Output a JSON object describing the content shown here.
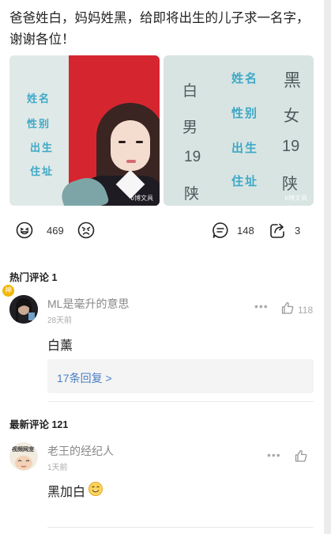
{
  "post": {
    "title": "爸爸姓白，妈妈姓黑，给即将出生的儿子求一名字，谢谢各位！"
  },
  "photo_left": {
    "fields": [
      "姓名",
      "性别",
      "出生",
      "住址"
    ],
    "watermark": "b博文具"
  },
  "photo_right": {
    "fields": [
      "姓名",
      "性别",
      "出生",
      "住址"
    ],
    "values": [
      "黑",
      "女",
      "19",
      "陕"
    ],
    "partial_chars": [
      "白",
      "男",
      "19",
      "陕"
    ],
    "watermark": "b博文具"
  },
  "actions": {
    "laugh_count": "469",
    "comment_count": "148",
    "share_count": "3"
  },
  "hot_comments": {
    "header": "热门评论 1",
    "items": [
      {
        "badge": "神",
        "username": "ML是毫升的意思",
        "time": "28天前",
        "likes": "118",
        "text": "白薰",
        "reply_link": "17条回复 >"
      }
    ]
  },
  "new_comments": {
    "header": "最新评论 121",
    "items": [
      {
        "avatar_text": "视频网宠",
        "username": "老王的经纪人",
        "time": "1天前",
        "text": "黑加白"
      }
    ]
  },
  "colors": {
    "accent": "#4a7fc4",
    "badge": "#f1b500",
    "id_card_red": "#d5262f",
    "id_card_text": "#3ea8c6"
  }
}
